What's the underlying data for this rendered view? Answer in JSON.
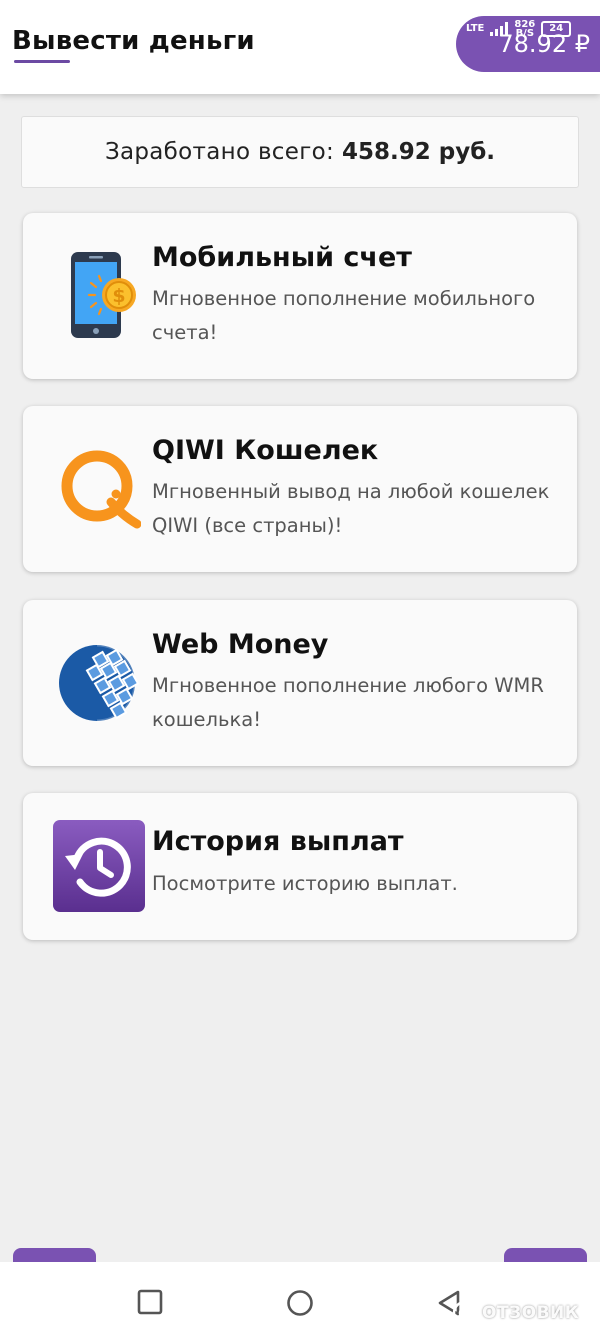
{
  "header": {
    "title": "Вывести деньги",
    "balance": "78.92 ₽",
    "status": {
      "network": "LTE",
      "speed_value": "826",
      "speed_unit": "B/S",
      "battery": "24"
    }
  },
  "earned": {
    "label": "Заработано всего:",
    "value": "458.92 руб."
  },
  "cards": [
    {
      "title": "Мобильный счет",
      "description": "Мгновенное пополнение мобильного счета!",
      "icon": "mobile-coin-icon"
    },
    {
      "title": "QIWI Кошелек",
      "description": "Мгновенный вывод на любой кошелек QIWI (все страны)!",
      "icon": "qiwi-logo-icon"
    },
    {
      "title": "Web Money",
      "description": "Мгновенное пополнение любого WMR кошелька!",
      "icon": "webmoney-logo-icon"
    },
    {
      "title": "История выплат",
      "description": "Посмотрите историю выплат.",
      "icon": "history-icon"
    }
  ],
  "watermark": "ОТЗОВИК",
  "colors": {
    "accent": "#7a52b2",
    "qiwi_orange": "#f7941d",
    "webmoney_blue": "#1b5aa6"
  }
}
